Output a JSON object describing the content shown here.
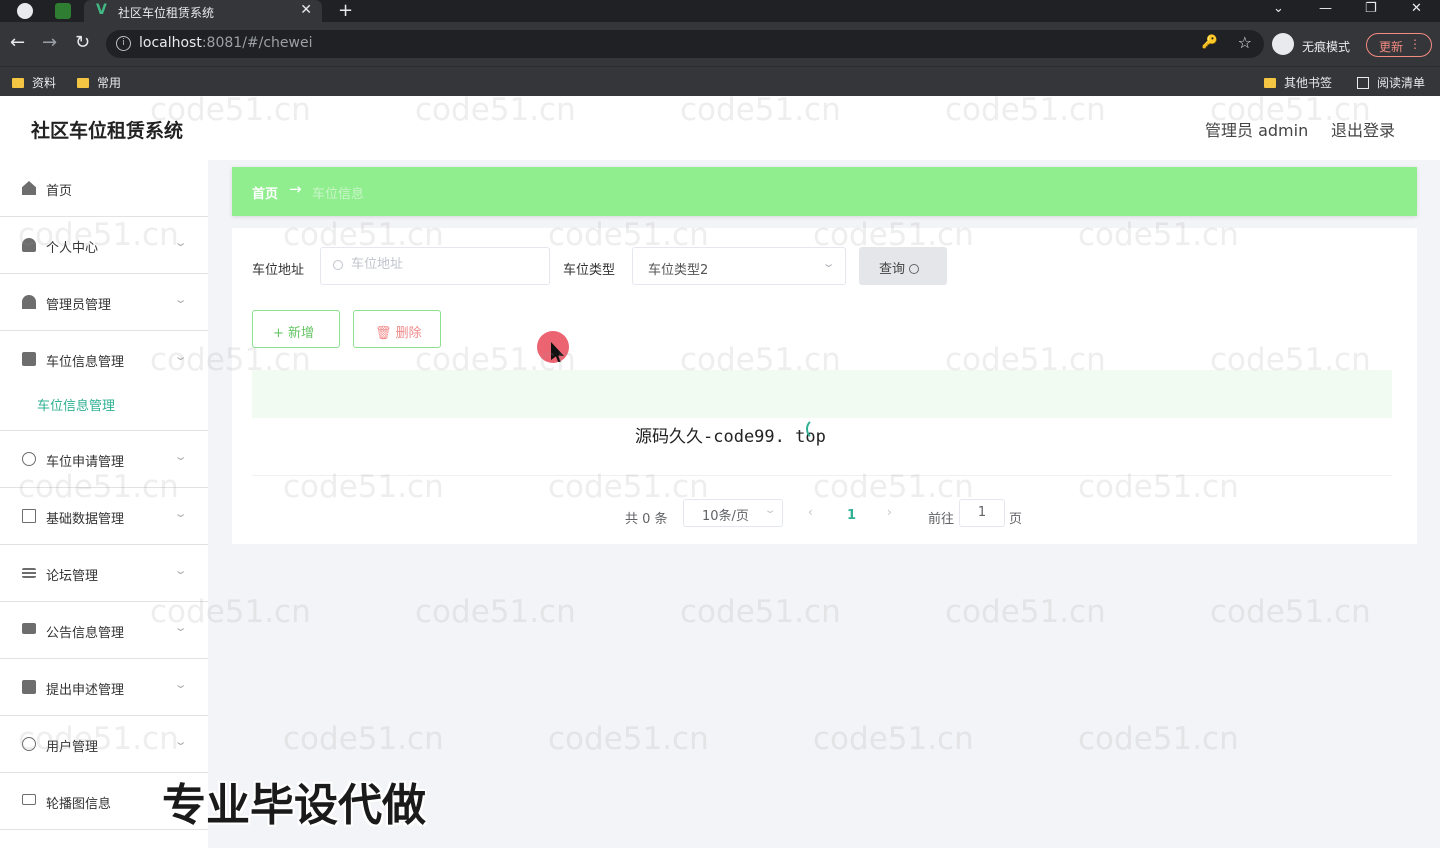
{
  "browser": {
    "tab_title": "社区车位租赁系统",
    "tab_close": "✕",
    "new_tab": "+",
    "url_host": "localhost",
    "url_path": ":8081/#/chewei",
    "incognito_label": "无痕模式",
    "update_label": "更新",
    "bookmarks": [
      "资料",
      "常用"
    ],
    "other_bookmarks": "其他书签",
    "reading_list": "阅读清单",
    "icons": {
      "back": "←",
      "forward": "→",
      "reload": "↻",
      "info": "i",
      "key": "🔑",
      "star": "☆",
      "minimize": "—",
      "restore": "❐",
      "close": "✕",
      "tab_dropdown": "⌄",
      "menu_dots": "⋮"
    }
  },
  "header": {
    "title": "社区车位租赁系统",
    "user": "管理员 admin",
    "logout": "退出登录"
  },
  "sidebar": {
    "items": [
      {
        "label": "首页",
        "icon": "home-icon"
      },
      {
        "label": "个人中心",
        "icon": "user-icon"
      },
      {
        "label": "管理员管理",
        "icon": "admin-icon"
      },
      {
        "label": "车位信息管理",
        "icon": "parking-icon"
      },
      {
        "label": "车位申请管理",
        "icon": "compass-icon"
      },
      {
        "label": "基础数据管理",
        "icon": "crop-icon"
      },
      {
        "label": "论坛管理",
        "icon": "sliders-icon"
      },
      {
        "label": "公告信息管理",
        "icon": "chat-icon"
      },
      {
        "label": "提出申述管理",
        "icon": "check-icon"
      },
      {
        "label": "用户管理",
        "icon": "power-icon"
      },
      {
        "label": "轮播图信息",
        "icon": "message-icon"
      }
    ],
    "active_sub": "车位信息管理",
    "chevron": "⌄"
  },
  "breadcrumb": {
    "home": "首页",
    "arrow": "→",
    "current": "车位信息"
  },
  "filters": {
    "address_label": "车位地址",
    "address_placeholder": "车位地址",
    "type_label": "车位类型",
    "type_value": "车位类型2",
    "query_label": "查询"
  },
  "actions": {
    "add_label": "+ 新增",
    "delete_label": "🗑 删除"
  },
  "pagination": {
    "total": "共 0 条",
    "page_size": "10条/页",
    "prev": "‹",
    "current_page": "1",
    "next": "›",
    "goto": "前往",
    "goto_value": "1",
    "unit": "页"
  },
  "overlays": {
    "center_text": "源码久久-code99. top",
    "bottom_text": "专业毕设代做",
    "watermark": "code51.cn"
  },
  "colors": {
    "accent_green": "#90ee8f",
    "active_text": "#2fb093",
    "delete_red": "#f08a8a"
  }
}
